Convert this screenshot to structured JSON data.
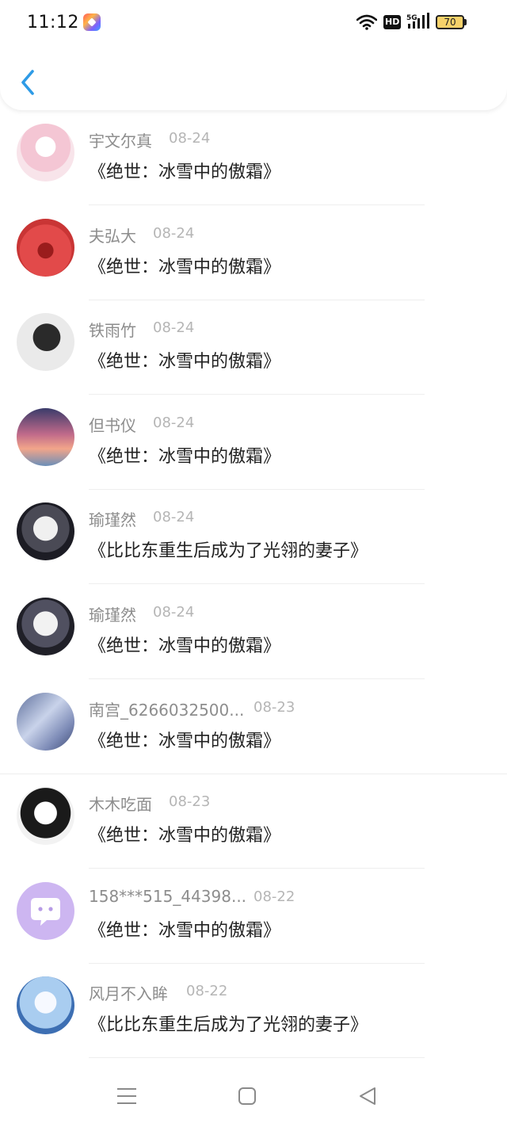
{
  "status_bar": {
    "time": "11:12",
    "hd_label": "HD",
    "network_label": "5G",
    "battery_level": "70"
  },
  "header": {
    "back_icon": "chevron-left-icon"
  },
  "records": [
    {
      "name": "宇文尔真",
      "date": "08-24",
      "book": "《绝世：冰雪中的傲霜》"
    },
    {
      "name": "夫弘大",
      "date": "08-24",
      "book": "《绝世：冰雪中的傲霜》"
    },
    {
      "name": "铁雨竹",
      "date": "08-24",
      "book": "《绝世：冰雪中的傲霜》"
    },
    {
      "name": "但书仪",
      "date": "08-24",
      "book": "《绝世：冰雪中的傲霜》"
    },
    {
      "name": "瑜瑾然",
      "date": "08-24",
      "book": "《比比东重生后成为了光翎的妻子》"
    },
    {
      "name": "瑜瑾然",
      "date": "08-24",
      "book": "《绝世：冰雪中的傲霜》"
    },
    {
      "name": "南宫_6266032500...",
      "date": "08-23",
      "book": "《绝世：冰雪中的傲霜》"
    },
    {
      "name": "木木吃面",
      "date": "08-23",
      "book": "《绝世：冰雪中的傲霜》"
    },
    {
      "name": "158***515_44398...",
      "date": "08-22",
      "book": "《绝世：冰雪中的傲霜》"
    },
    {
      "name": "风月不入眸",
      "date": "08-22",
      "book": "《比比东重生后成为了光翎的妻子》"
    }
  ],
  "nav": {
    "menu_icon": "menu-icon",
    "home_icon": "home-square-icon",
    "back_icon": "back-triangle-icon"
  },
  "colors": {
    "accent": "#2e9be6",
    "name_text": "#8d8d8d",
    "date_text": "#b5b5b5",
    "book_text": "#222222"
  }
}
